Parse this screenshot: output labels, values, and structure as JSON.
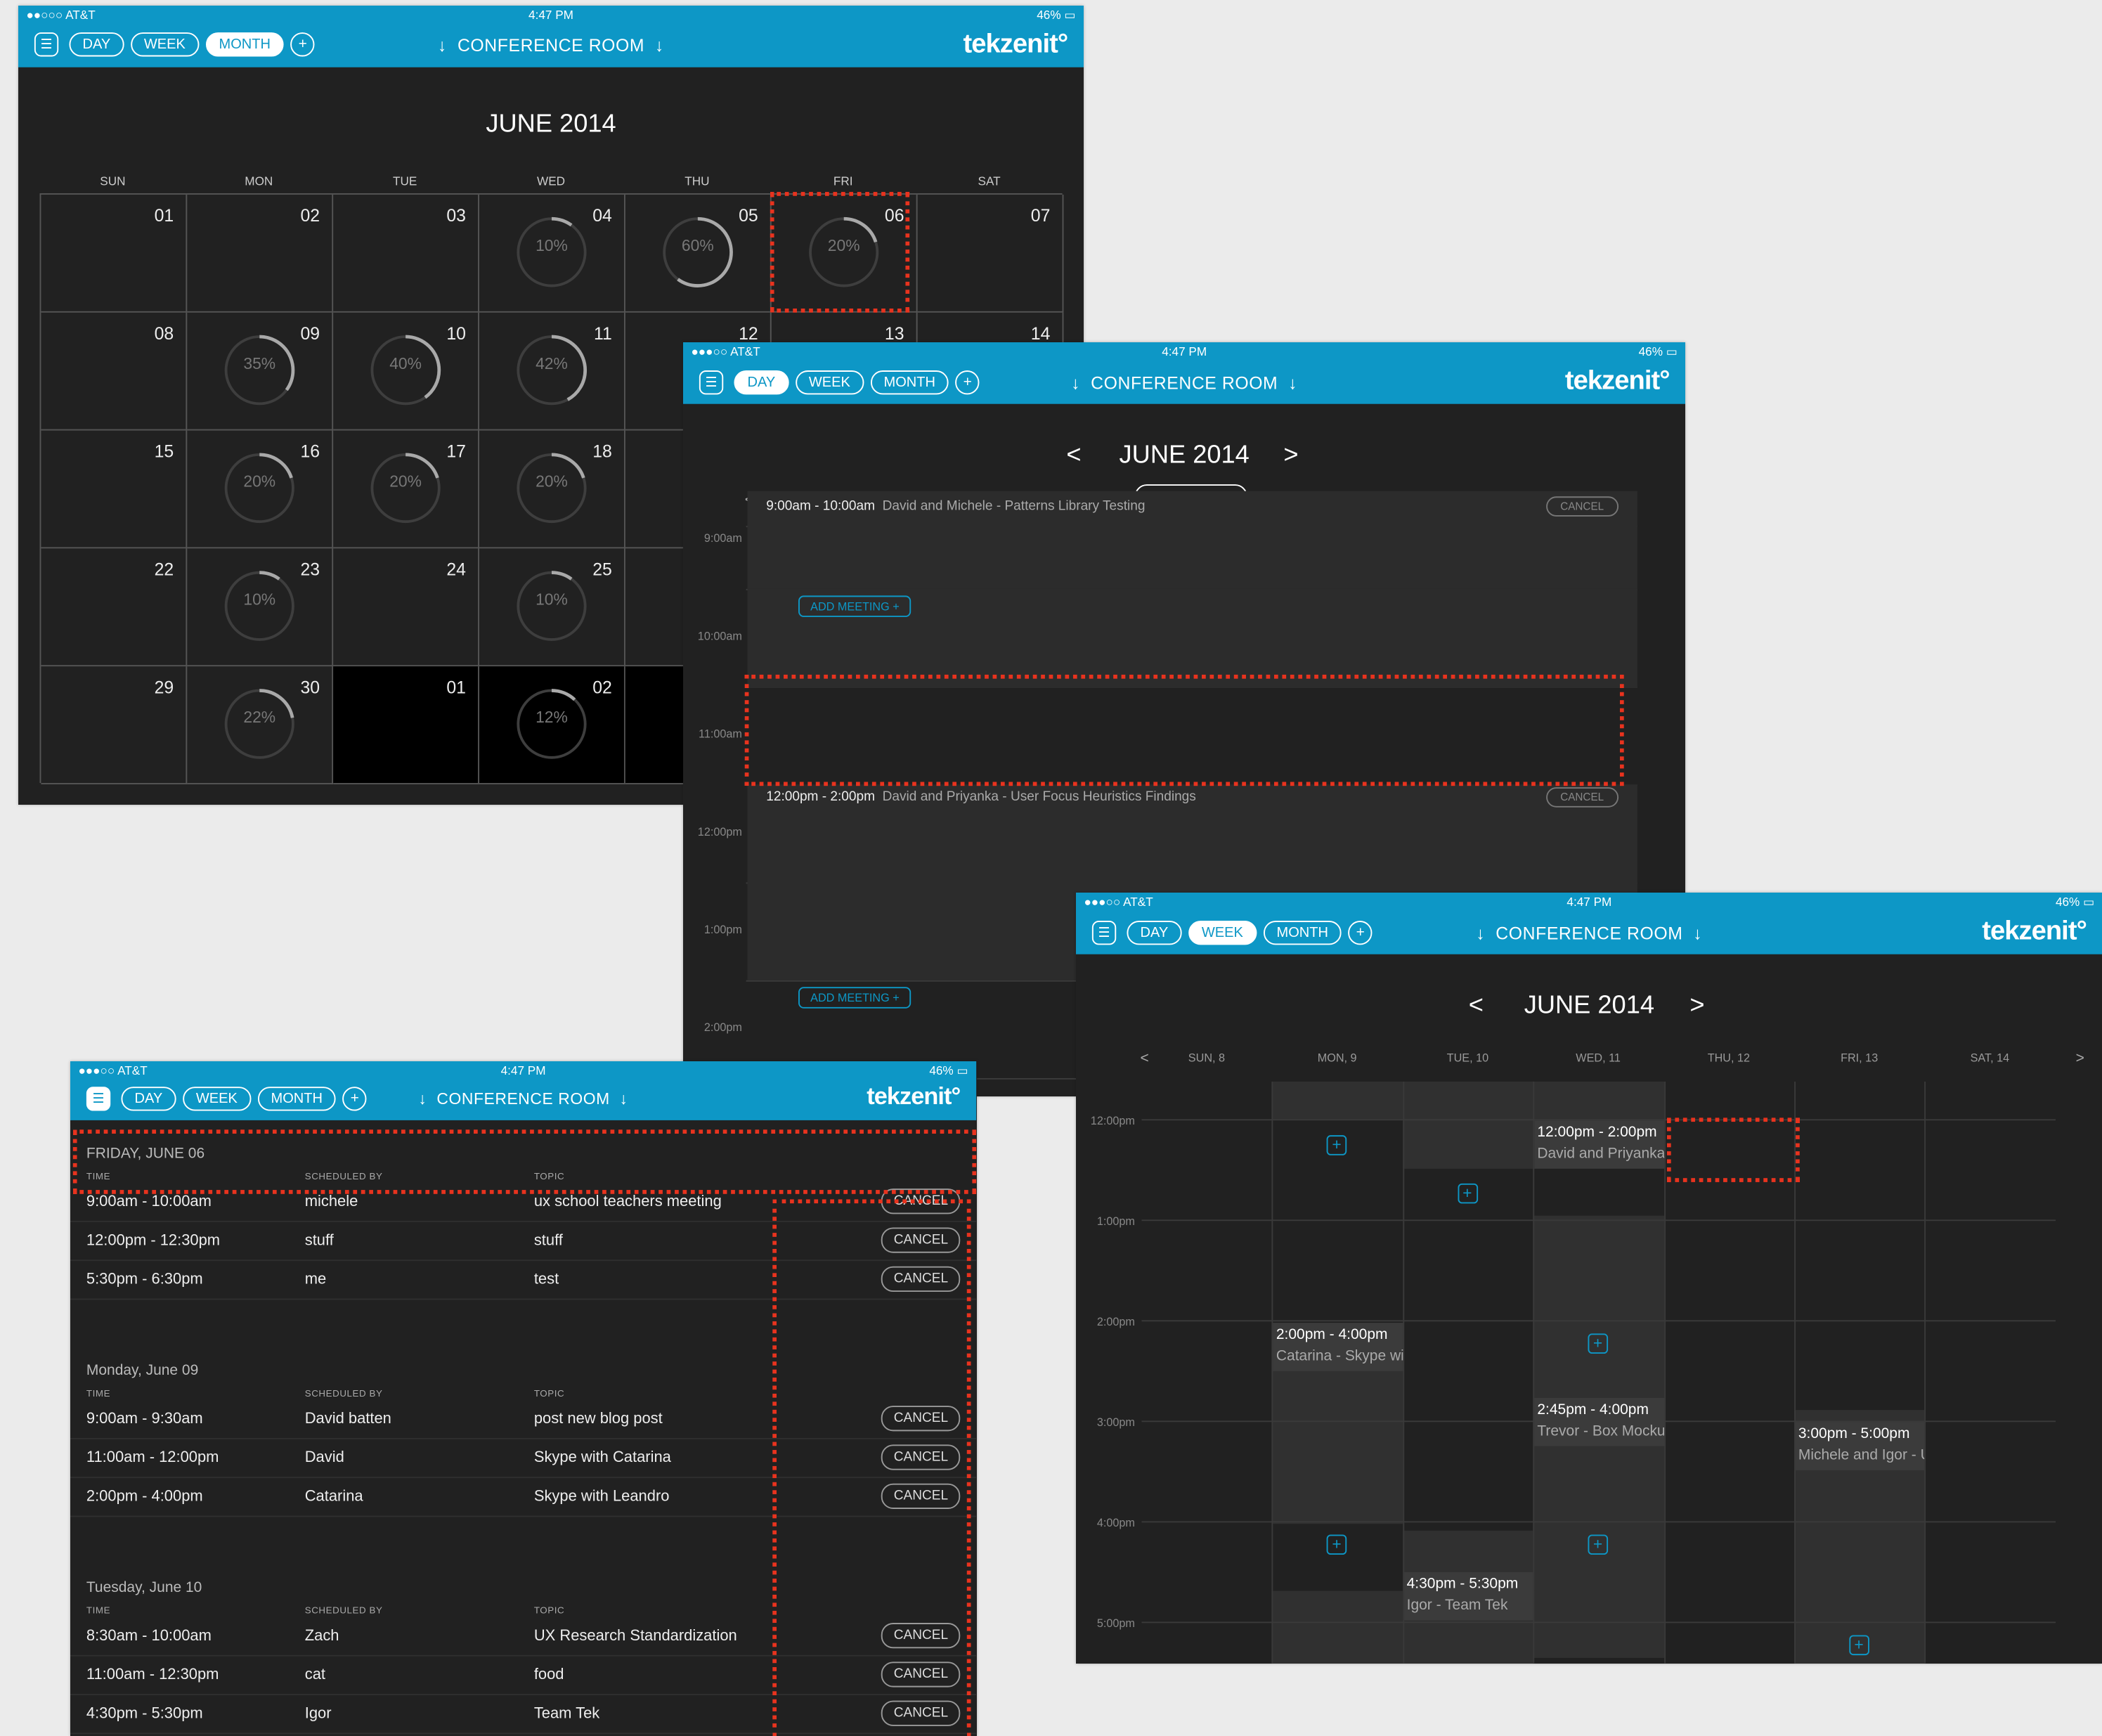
{
  "common": {
    "carrier": "AT&T",
    "time": "4:47 PM",
    "battery": "46%",
    "btn_day": "DAY",
    "btn_week": "WEEK",
    "btn_month": "MONTH",
    "btn_plus": "+",
    "room": "CONFERENCE ROOM",
    "logo": "tekzenit°",
    "accent": "#0d97c6",
    "highlight": "#e8331e"
  },
  "month": {
    "title": "JUNE 2014",
    "weekdays": [
      "SUN",
      "MON",
      "TUE",
      "WED",
      "THU",
      "FRI",
      "SAT"
    ],
    "cells": [
      {
        "n": "01",
        "p": null
      },
      {
        "n": "02",
        "p": null
      },
      {
        "n": "03",
        "p": null
      },
      {
        "n": "04",
        "p": "10%"
      },
      {
        "n": "05",
        "p": "60%"
      },
      {
        "n": "06",
        "p": "20%"
      },
      {
        "n": "07",
        "p": null
      },
      {
        "n": "08",
        "p": null
      },
      {
        "n": "09",
        "p": "35%"
      },
      {
        "n": "10",
        "p": "40%"
      },
      {
        "n": "11",
        "p": "42%"
      },
      {
        "n": "12",
        "p": null
      },
      {
        "n": "13",
        "p": null
      },
      {
        "n": "14",
        "p": null
      },
      {
        "n": "15",
        "p": null
      },
      {
        "n": "16",
        "p": "20%"
      },
      {
        "n": "17",
        "p": "20%"
      },
      {
        "n": "18",
        "p": "20%"
      },
      {
        "n": "",
        "p": null
      },
      {
        "n": "",
        "p": null
      },
      {
        "n": "",
        "p": null
      },
      {
        "n": "22",
        "p": null
      },
      {
        "n": "23",
        "p": "10%"
      },
      {
        "n": "24",
        "p": null
      },
      {
        "n": "25",
        "p": "10%"
      },
      {
        "n": "",
        "p": null
      },
      {
        "n": "",
        "p": null
      },
      {
        "n": "",
        "p": null
      },
      {
        "n": "29",
        "p": null
      },
      {
        "n": "30",
        "p": "22%"
      },
      {
        "n": "01",
        "p": null
      },
      {
        "n": "02",
        "p": "12%"
      },
      {
        "n": "",
        "p": null
      },
      {
        "n": "",
        "p": null
      },
      {
        "n": "",
        "p": null
      }
    ]
  },
  "day": {
    "prev": "<",
    "next": ">",
    "title": "JUNE 2014",
    "days": [
      "SUN, 8",
      "MON, 9",
      "TUE, 10",
      "WED, 11",
      "THU, 12",
      "FRI, 13",
      "SAT, 14"
    ],
    "hours": [
      "9:00am",
      "10:00am",
      "11:00am",
      "12:00pm",
      "1:00pm",
      "2:00pm"
    ],
    "event1_time": "9:00am - 10:00am",
    "event1_desc": "David and Michele - Patterns Library Testing",
    "event2_time": "12:00pm - 2:00pm",
    "event2_desc": "David and Priyanka - User Focus Heuristics Findings",
    "cancel": "CANCEL",
    "add_meeting": "ADD MEETING +"
  },
  "list": {
    "colheads": {
      "time": "TIME",
      "by": "SCHEDULED BY",
      "topic": "TOPIC"
    },
    "cancel": "CANCEL",
    "sections": [
      {
        "title": "FRIDAY, JUNE 06",
        "rows": [
          {
            "time": "9:00am - 10:00am",
            "by": "michele",
            "topic": "ux school teachers meeting"
          },
          {
            "time": "12:00pm - 12:30pm",
            "by": "stuff",
            "topic": "stuff"
          },
          {
            "time": "5:30pm - 6:30pm",
            "by": "me",
            "topic": "test"
          }
        ]
      },
      {
        "title": "Monday, June 09",
        "rows": [
          {
            "time": "9:00am - 9:30am",
            "by": "David batten",
            "topic": "post new blog post"
          },
          {
            "time": "11:00am - 12:00pm",
            "by": "David",
            "topic": "Skype with Catarina"
          },
          {
            "time": "2:00pm - 4:00pm",
            "by": "Catarina",
            "topic": "Skype with Leandro"
          }
        ]
      },
      {
        "title": "Tuesday, June 10",
        "rows": [
          {
            "time": "8:30am - 10:00am",
            "by": "Zach",
            "topic": "UX Research Standardization"
          },
          {
            "time": "11:00am - 12:30pm",
            "by": "cat",
            "topic": "food"
          },
          {
            "time": "4:30pm - 5:30pm",
            "by": "Igor",
            "topic": "Team Tek"
          }
        ]
      }
    ]
  },
  "week": {
    "prev": "<",
    "next": ">",
    "title": "JUNE 2014",
    "days": [
      "SUN, 8",
      "MON, 9",
      "TUE, 10",
      "WED, 11",
      "THU, 12",
      "FRI, 13",
      "SAT, 14"
    ],
    "hours": [
      "12:00pm",
      "1:00pm",
      "2:00pm",
      "3:00pm",
      "4:00pm",
      "5:00pm"
    ],
    "events": [
      {
        "time": "12:00pm - 2:00pm",
        "who": "David and Priyanka"
      },
      {
        "time": "2:00pm - 4:00pm",
        "who": "Catarina - Skype wi"
      },
      {
        "time": "2:45pm - 4:00pm",
        "who": "Trevor - Box Mocku"
      },
      {
        "time": "3:00pm - 5:00pm",
        "who": "Michele and Igor - U"
      },
      {
        "time": "4:30pm - 5:30pm",
        "who": "Igor - Team Tek"
      }
    ]
  }
}
